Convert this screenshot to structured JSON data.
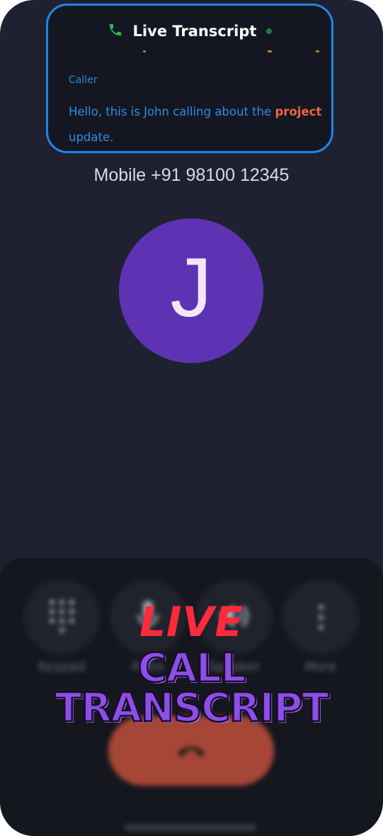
{
  "transcript": {
    "title": "Live Transcript",
    "speaker": "Caller",
    "text_before": "Hello, this is John calling about the ",
    "highlight": "project",
    "text_after": " update."
  },
  "caller": {
    "number": "Mobile +91 98100 12345",
    "avatar_letter": "J"
  },
  "controls": {
    "buttons": [
      {
        "label": "Keypad",
        "icon": "keypad-icon"
      },
      {
        "label": "Mute",
        "icon": "mic-icon"
      },
      {
        "label": "Speaker",
        "icon": "speaker-icon"
      },
      {
        "label": "More",
        "icon": "more-vert-icon"
      }
    ],
    "end_call_icon": "end-call-icon"
  },
  "promo": {
    "line1": "LIVE",
    "line2": "CALL",
    "line3": "TRANSCRIPT"
  },
  "colors": {
    "background": "#1f2130",
    "transcript_border": "#1f86e6",
    "avatar": "#5e33b3",
    "end_call": "#a64637",
    "promo_red": "#ff2a3a",
    "promo_purple": "#8b4fe6",
    "highlight": "#f0663c"
  }
}
